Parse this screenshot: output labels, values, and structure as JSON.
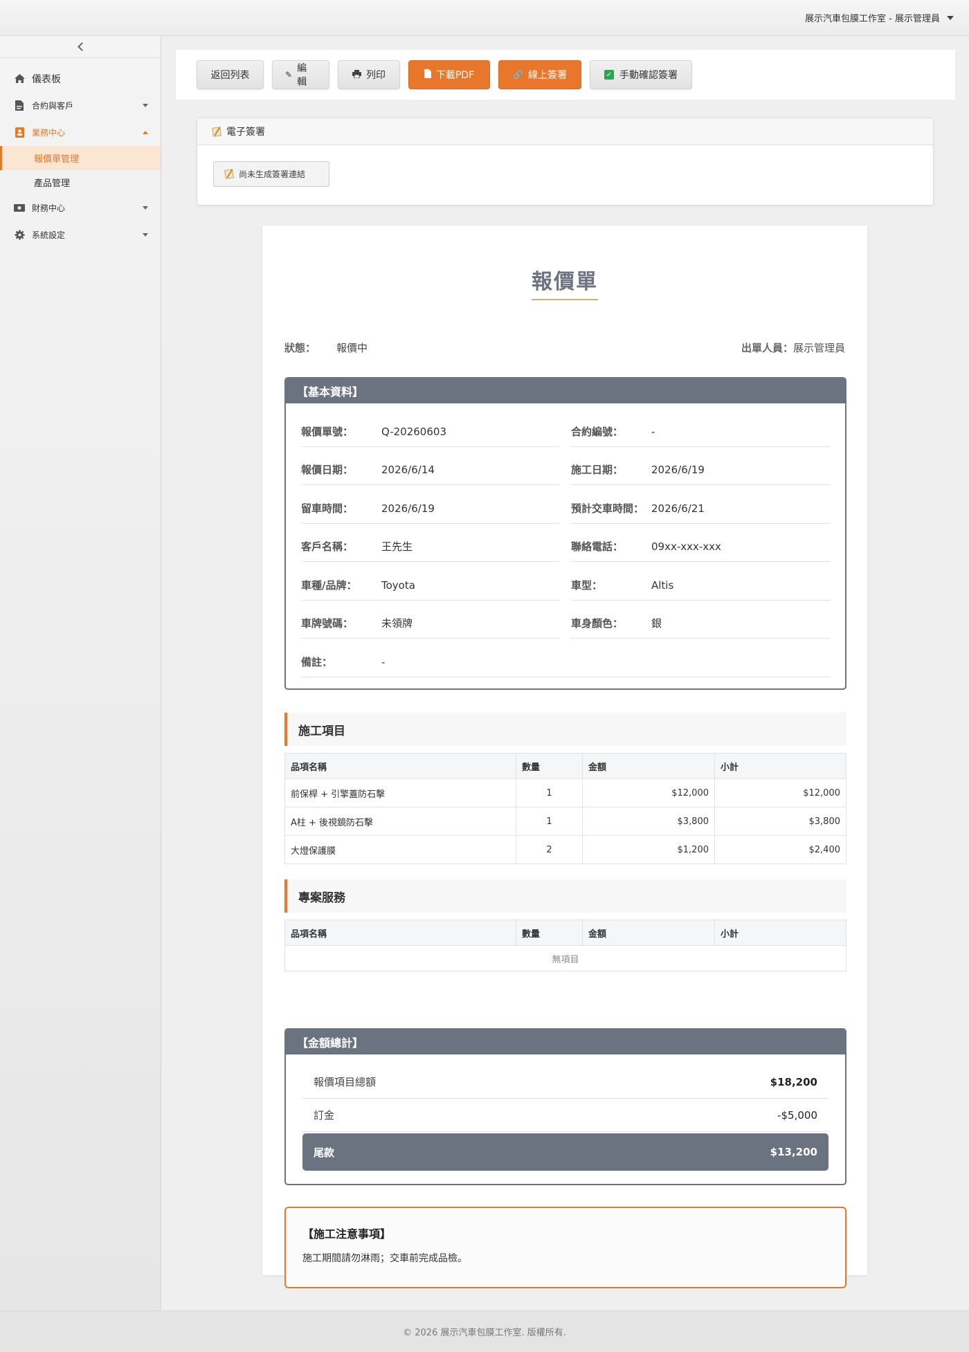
{
  "header": {
    "user_menu": "展示汽車包膜工作室 - 展示管理員"
  },
  "sidebar": {
    "items": [
      {
        "label": "儀表板",
        "icon": "home-icon"
      },
      {
        "label": "合約與客戶",
        "icon": "document-icon"
      },
      {
        "label": "業務中心",
        "icon": "contact-card-icon",
        "expanded": true
      },
      {
        "label": "財務中心",
        "icon": "money-icon"
      },
      {
        "label": "系統設定",
        "icon": "gear-icon"
      }
    ],
    "sub_items": [
      {
        "label": "報價單管理",
        "current": true
      },
      {
        "label": "產品管理"
      }
    ]
  },
  "toolbar": {
    "back": "返回列表",
    "edit": "編輯",
    "print": "列印",
    "pdf": "下載PDF",
    "sign": "線上簽署",
    "confirm": "手動確認簽署"
  },
  "signature": {
    "title": "電子簽署",
    "button": "尚未生成簽署連結"
  },
  "document": {
    "title": "報價單",
    "status_label": "狀態：",
    "status_value": "報價中",
    "issuer_label": "出單人員：",
    "issuer_value": "展示管理員",
    "basic_title": "【基本資料】",
    "fields": [
      {
        "label": "報價單號：",
        "value": "Q-20260603"
      },
      {
        "label": "合約編號：",
        "value": "-"
      },
      {
        "label": "報價日期：",
        "value": "2026/6/14"
      },
      {
        "label": "施工日期：",
        "value": "2026/6/19"
      },
      {
        "label": "留車時間：",
        "value": "2026/6/19"
      },
      {
        "label": "預計交車時間：",
        "value": "2026/6/21"
      },
      {
        "label": "客戶名稱：",
        "value": "王先生"
      },
      {
        "label": "聯絡電話：",
        "value": "09xx-xxx-xxx"
      },
      {
        "label": "車種/品牌：",
        "value": "Toyota"
      },
      {
        "label": "車型：",
        "value": "Altis"
      },
      {
        "label": "車牌號碼：",
        "value": "未領牌"
      },
      {
        "label": "車身顏色：",
        "value": "銀"
      },
      {
        "label": "備註：",
        "value": "-"
      }
    ],
    "columns": [
      "品項名稱",
      "數量",
      "金額",
      "小計"
    ],
    "construction_title": "施工項目",
    "construction_items": [
      {
        "name": "前保桿 + 引擎蓋防石擊",
        "qty": "1",
        "price": "$12,000",
        "subtotal": "$12,000"
      },
      {
        "name": "A柱 + 後視鏡防石擊",
        "qty": "1",
        "price": "$3,800",
        "subtotal": "$3,800"
      },
      {
        "name": "大燈保護膜",
        "qty": "2",
        "price": "$1,200",
        "subtotal": "$2,400"
      }
    ],
    "service_title": "專案服務",
    "service_empty": "無項目",
    "totals_title": "【金額總計】",
    "totals": [
      {
        "label": "報價項目總額",
        "value": "$18,200"
      },
      {
        "label": "訂金",
        "value": "-$5,000"
      },
      {
        "label": "尾款",
        "value": "$13,200"
      }
    ],
    "notes_title": "【施工注意事項】",
    "notes_text": "施工期間請勿淋雨；交車前完成品檢。"
  },
  "footer": {
    "text": "© 2026 展示汽車包膜工作室. 版權所有."
  },
  "colors": {
    "accent": "#e8762b",
    "slate": "#6b7280"
  }
}
